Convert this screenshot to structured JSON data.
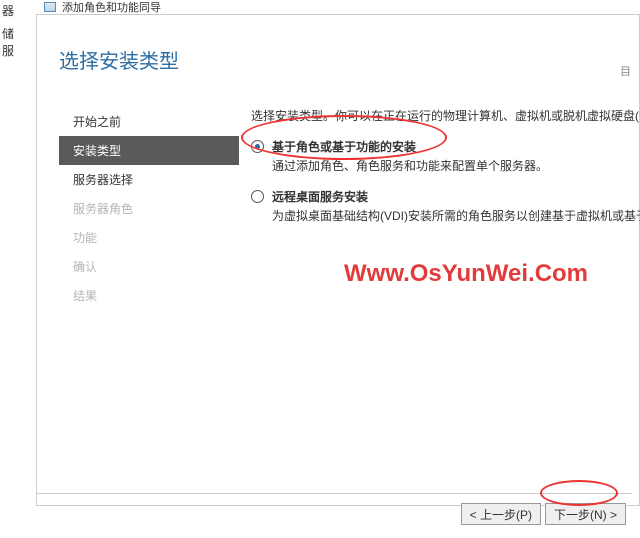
{
  "left_edge": {
    "line1": "器",
    "line2": "储服"
  },
  "topbar_label": "添加角色和功能同导",
  "wizard_title": "选择安装类型",
  "dest_label": "目",
  "instruction": "选择安装类型。你可以在正在运行的物理计算机、虚拟机或脱机虚拟硬盘(",
  "nav": {
    "items": [
      {
        "label": "开始之前",
        "state": ""
      },
      {
        "label": "安装类型",
        "state": "selected"
      },
      {
        "label": "服务器选择",
        "state": ""
      },
      {
        "label": "服务器角色",
        "state": "disabled"
      },
      {
        "label": "功能",
        "state": "disabled"
      },
      {
        "label": "确认",
        "state": "disabled"
      },
      {
        "label": "结果",
        "state": "disabled"
      }
    ]
  },
  "options": [
    {
      "title": "基于角色或基于功能的安装",
      "desc": "通过添加角色、角色服务和功能来配置单个服务器。",
      "checked": true
    },
    {
      "title": "远程桌面服务安装",
      "desc": "为虚拟桌面基础结构(VDI)安装所需的角色服务以创建基于虚拟机或基于",
      "checked": false
    }
  ],
  "buttons": {
    "prev": "< 上一步(P)",
    "next": "下一步(N) >"
  },
  "watermark": "Www.OsYunWei.Com"
}
